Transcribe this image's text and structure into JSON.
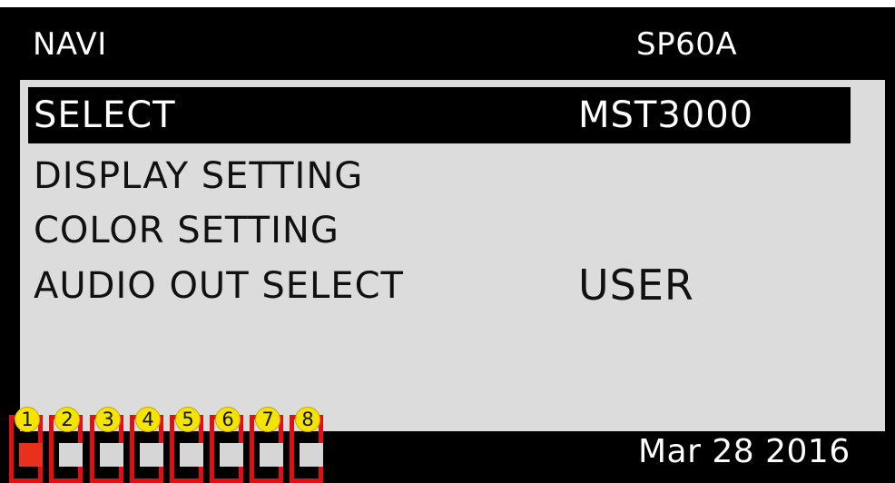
{
  "header": {
    "title": "NAVI",
    "model": "SP60A"
  },
  "menu": {
    "items": [
      {
        "label": "SELECT",
        "value": "MST3000",
        "selected": true
      },
      {
        "label": "DISPLAY SETTING",
        "value": ""
      },
      {
        "label": "COLOR SETTING",
        "value": ""
      },
      {
        "label": "AUDIO OUT SELECT",
        "value": "USER"
      }
    ]
  },
  "slots": [
    {
      "number": "1",
      "active": true
    },
    {
      "number": "2",
      "active": false
    },
    {
      "number": "3",
      "active": false
    },
    {
      "number": "4",
      "active": false
    },
    {
      "number": "5",
      "active": false
    },
    {
      "number": "6",
      "active": false
    },
    {
      "number": "7",
      "active": false
    },
    {
      "number": "8",
      "active": false
    }
  ],
  "footer": {
    "date": "Mar 28 2016"
  },
  "colors": {
    "background": "#000000",
    "menu_bg": "#dcdcdc",
    "highlight_border": "#e10f14",
    "active_slot": "#e8301c",
    "badge": "#f4e400"
  }
}
